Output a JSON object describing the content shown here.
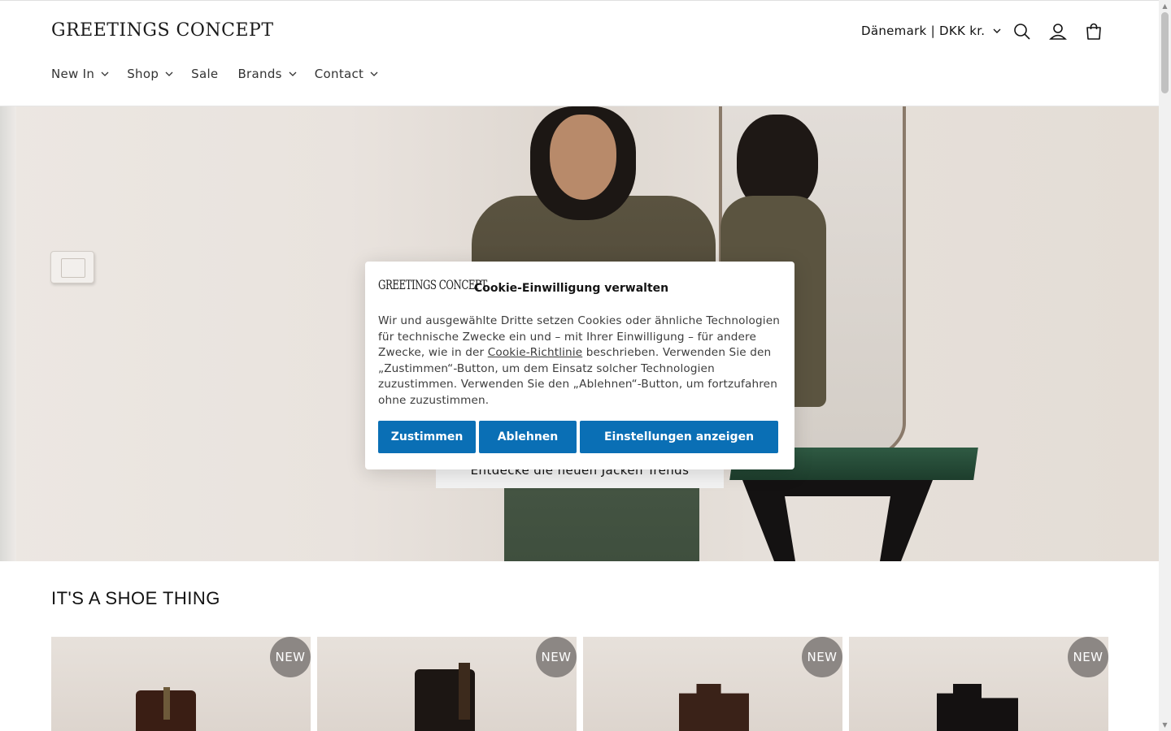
{
  "header": {
    "logo": "GREETINGS CONCEPT",
    "country_selector": "Dänemark | DKK kr.",
    "icons": [
      "search-icon",
      "account-icon",
      "cart-icon"
    ]
  },
  "nav": {
    "items": [
      {
        "label": "New In",
        "has_dropdown": true
      },
      {
        "label": "Shop",
        "has_dropdown": true
      },
      {
        "label": "Sale",
        "has_dropdown": false
      },
      {
        "label": "Brands",
        "has_dropdown": true
      },
      {
        "label": "Contact",
        "has_dropdown": true
      }
    ]
  },
  "hero": {
    "button_label": "Entdecke die neuen Jacken Trends"
  },
  "section": {
    "title": "IT'S A SHOE THING",
    "products": [
      {
        "badge": "NEW"
      },
      {
        "badge": "NEW"
      },
      {
        "badge": "NEW"
      },
      {
        "badge": "NEW"
      }
    ]
  },
  "cookie": {
    "logo": "GREETINGS CONCEPT",
    "title": "Cookie-Einwilligung verwalten",
    "text_before_link": "Wir und ausgewählte Dritte setzen Cookies oder ähnliche Technologien für technische Zwecke ein und – mit Ihrer Einwilligung – für andere Zwecke, wie in der ",
    "link_text": "Cookie-Richtlinie",
    "text_after_link": " beschrieben. Verwenden Sie den „Zustimmen“-Button, um dem Einsatz solcher Technologien zuzustimmen. Verwenden Sie den „Ablehnen“-Button, um fortzufahren ohne zuzustimmen.",
    "accept_label": "Zustimmen",
    "reject_label": "Ablehnen",
    "settings_label": "Einstellungen anzeigen"
  },
  "colors": {
    "button_blue": "#0a6fb5",
    "badge_gray": "#8c8784"
  }
}
